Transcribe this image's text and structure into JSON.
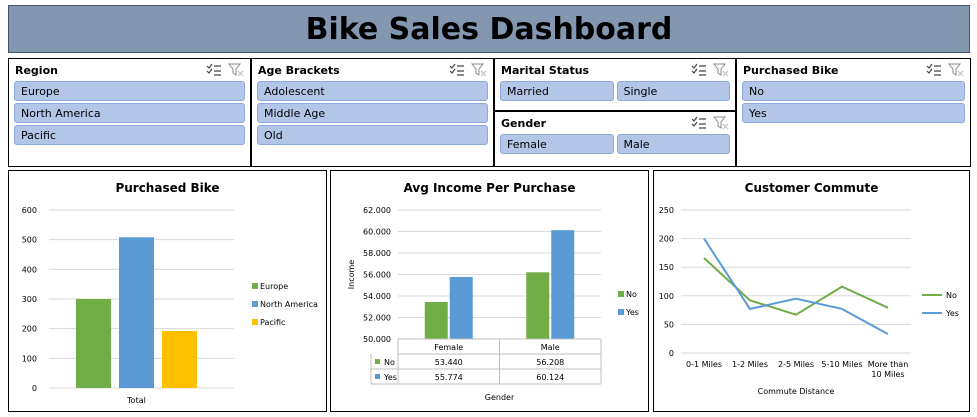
{
  "dashboard": {
    "title": "Bike Sales Dashboard"
  },
  "slicers": {
    "region": {
      "title": "Region",
      "items": [
        "Europe",
        "North America",
        "Pacific"
      ]
    },
    "age": {
      "title": "Age Brackets",
      "items": [
        "Adolescent",
        "Middle Age",
        "Old"
      ]
    },
    "marital": {
      "title": "Marital Status",
      "items": [
        "Married",
        "Single"
      ]
    },
    "gender": {
      "title": "Gender",
      "items": [
        "Female",
        "Male"
      ]
    },
    "purchased": {
      "title": "Purchased Bike",
      "items": [
        "No",
        "Yes"
      ]
    }
  },
  "icons": {
    "multiselect": "multi-select-icon",
    "clear_filter": "clear-filter-icon"
  },
  "colors": {
    "green": "#70ad47",
    "blue": "#5b9bd5",
    "gold": "#ffc000",
    "grid": "#d9d9d9"
  },
  "chart_data": [
    {
      "type": "bar",
      "title": "Purchased Bike",
      "categories": [
        "Total"
      ],
      "series": [
        {
          "name": "Europe",
          "values": [
            300
          ]
        },
        {
          "name": "North America",
          "values": [
            508
          ]
        },
        {
          "name": "Pacific",
          "values": [
            192
          ]
        }
      ],
      "ylim": [
        0,
        600
      ],
      "yticks": [
        "0",
        "100",
        "200",
        "300",
        "400",
        "500",
        "600"
      ],
      "grid": true,
      "legend": "right"
    },
    {
      "type": "bar",
      "title": "Avg Income Per Purchase",
      "categories": [
        "Female",
        "Male"
      ],
      "series": [
        {
          "name": "No",
          "values": [
            53.44,
            56.208
          ],
          "labels": [
            "53.440",
            "56.208"
          ]
        },
        {
          "name": "Yes",
          "values": [
            55.774,
            60.124
          ],
          "labels": [
            "55.774",
            "60.124"
          ]
        }
      ],
      "xlabel": "Gender",
      "ylabel": "Income",
      "ylim": [
        50,
        62
      ],
      "yticks": [
        "50.000",
        "52.000",
        "54.000",
        "56.000",
        "58.000",
        "60.000",
        "62.000"
      ],
      "grid": true,
      "legend": "right",
      "data_table": true
    },
    {
      "type": "line",
      "title": "Customer Commute",
      "categories": [
        "0-1 Miles",
        "1-2 Miles",
        "2-5 Miles",
        "5-10 Miles",
        "More than 10 Miles"
      ],
      "series": [
        {
          "name": "No",
          "values": [
            166,
            92,
            67,
            116,
            79
          ]
        },
        {
          "name": "Yes",
          "values": [
            200,
            77,
            95,
            77,
            33
          ]
        }
      ],
      "xlabel": "Commute Distance",
      "ylim": [
        0,
        250
      ],
      "yticks": [
        "0",
        "50",
        "100",
        "150",
        "200",
        "250"
      ],
      "grid": true,
      "legend": "right"
    }
  ]
}
